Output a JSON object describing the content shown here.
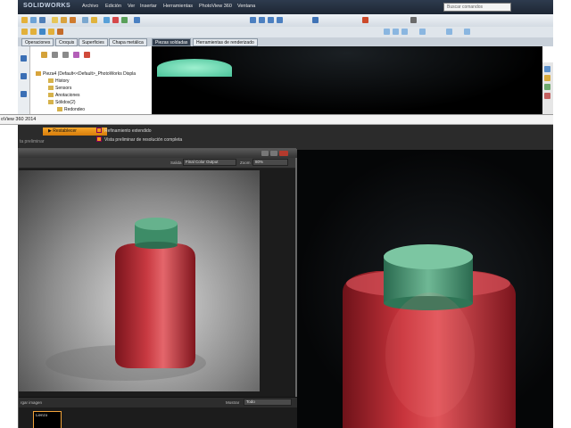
{
  "app": {
    "name": "SOLIDWORKS",
    "menus": [
      "Archivo",
      "Edición",
      "Ver",
      "Insertar",
      "Herramientas",
      "PhotoView 360",
      "Ventana"
    ],
    "search_placeholder": "Buscar comandos"
  },
  "tabs": [
    {
      "label": "Operaciones"
    },
    {
      "label": "Croquis"
    },
    {
      "label": "Superficies"
    },
    {
      "label": "Chapa metálica"
    },
    {
      "label": "Piezas soldadas",
      "active": true
    },
    {
      "label": "Herramientas de renderizado"
    }
  ],
  "tree": {
    "root": "Pieza4  (Default<<Default>_PhotoWorks Displa",
    "items": [
      "History",
      "Sensors",
      "Anotaciones",
      "Sólidos(2)",
      "Redondeo"
    ]
  },
  "photoview": {
    "title": "oView 360 2014",
    "reset_label": "Restablecer",
    "preview_label": "ta preliminar",
    "options": [
      {
        "label": "Refinamiento extendido",
        "checked": true
      },
      {
        "label": "Vista preliminar de resolución completa",
        "checked": true
      }
    ],
    "output_label": "Salida",
    "output_value": "Final Color Output",
    "zoom_label": "Zoom",
    "zoom_value": "80%",
    "save_image_label": "rgar imagen",
    "show_label": "Mostrar",
    "show_value": "Todo",
    "thumb_label": "Lienzo"
  },
  "colors": {
    "accent": "#f29a19",
    "bottle_red": "#b42a32",
    "cap_green": "#3f8c6b"
  }
}
